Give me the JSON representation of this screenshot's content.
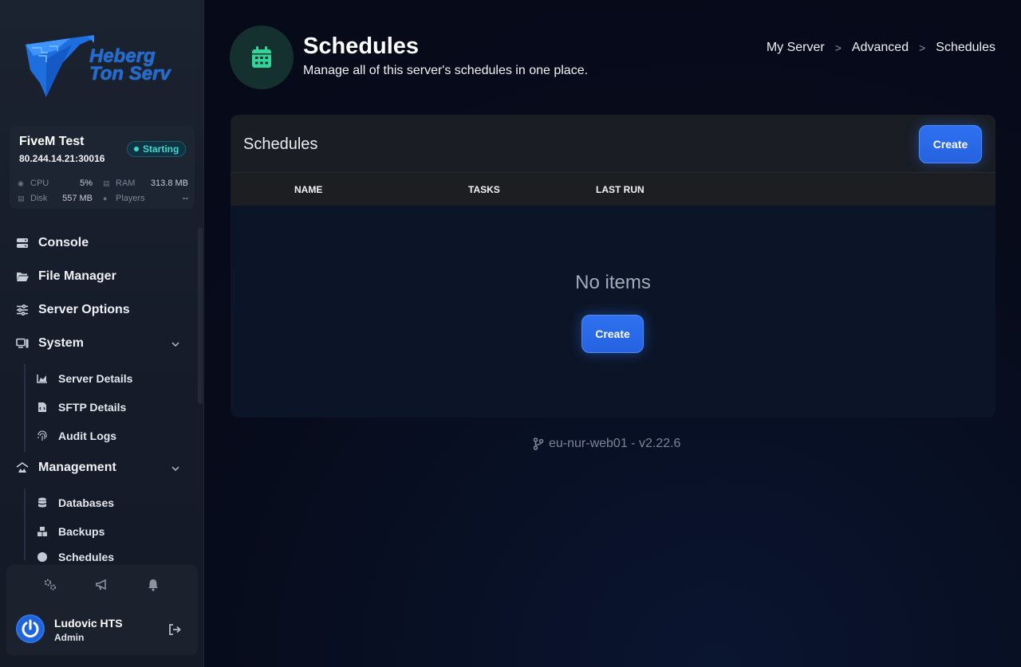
{
  "brand": {
    "line1": "Heberg",
    "line2": "Ton Serv"
  },
  "server": {
    "name": "FiveM Test",
    "address": "80.244.14.21:30016",
    "status": "Starting",
    "stats": {
      "cpu_label": "CPU",
      "cpu_value": "5%",
      "ram_label": "RAM",
      "ram_value": "313.8 MB",
      "disk_label": "Disk",
      "disk_value": "557 MB",
      "players_label": "Players",
      "players_value": "--"
    }
  },
  "nav": {
    "console": "Console",
    "file_manager": "File Manager",
    "server_options": "Server Options",
    "system": "System",
    "system_items": [
      "Server Details",
      "SFTP Details",
      "Audit Logs"
    ],
    "management": "Management",
    "management_items": [
      "Databases",
      "Backups",
      "Schedules"
    ]
  },
  "user": {
    "name": "Ludovic HTS",
    "role": "Admin"
  },
  "header": {
    "title": "Schedules",
    "subtitle": "Manage all of this server's schedules in one place.",
    "breadcrumb": [
      "My Server",
      "Advanced",
      "Schedules"
    ]
  },
  "panel": {
    "title": "Schedules",
    "create_label": "Create",
    "columns": [
      "NAME",
      "TASKS",
      "LAST RUN"
    ],
    "empty_text": "No items",
    "empty_create_label": "Create"
  },
  "footer": {
    "version": "eu-nur-web01 - v2.22.6"
  },
  "colors": {
    "accent": "#2e71f0",
    "status": "#3fd6d3",
    "icon_green": "#34d399"
  }
}
